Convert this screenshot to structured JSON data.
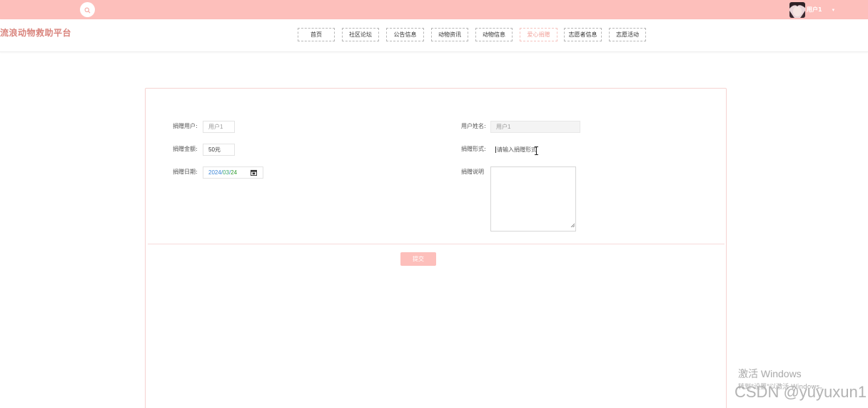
{
  "topbar": {
    "search_icon": "search-icon",
    "user": {
      "name": "用户1",
      "caret": "▾"
    }
  },
  "header": {
    "brand": "流浪动物救助平台",
    "nav": [
      {
        "label": "首页",
        "active": false
      },
      {
        "label": "社区论坛",
        "active": false
      },
      {
        "label": "公告信息",
        "active": false
      },
      {
        "label": "动物资讯",
        "active": false
      },
      {
        "label": "动物信息",
        "active": false
      },
      {
        "label": "爱心捐赠",
        "active": true
      },
      {
        "label": "志愿者信息",
        "active": false
      },
      {
        "label": "志愿活动",
        "active": false
      }
    ]
  },
  "form": {
    "donor_user": {
      "label": "捐赠用户:",
      "value": "用户1"
    },
    "user_name": {
      "label": "用户姓名:",
      "value": "用户1"
    },
    "amount": {
      "label": "捐赠金额:",
      "value": "50元"
    },
    "donation_type": {
      "label": "捐赠形式:",
      "placeholder": "请输入捐赠形式"
    },
    "date": {
      "label": "捐赠日期:",
      "year": "2024",
      "sep": "/",
      "month": "03",
      "day": "24"
    },
    "description": {
      "label": "捐赠说明",
      "value": ""
    },
    "submit_label": "提交"
  },
  "watermarks": {
    "windows_line1": "激活 Windows",
    "windows_line2": "转到\"设置\"以激活 Windows。",
    "csdn": "CSDN @yuyuxun1"
  },
  "colors": {
    "topbar": "#fdbfbb",
    "brand": "#d9847d",
    "active_nav": "#f2a39c",
    "submit": "#fdbfbb"
  }
}
